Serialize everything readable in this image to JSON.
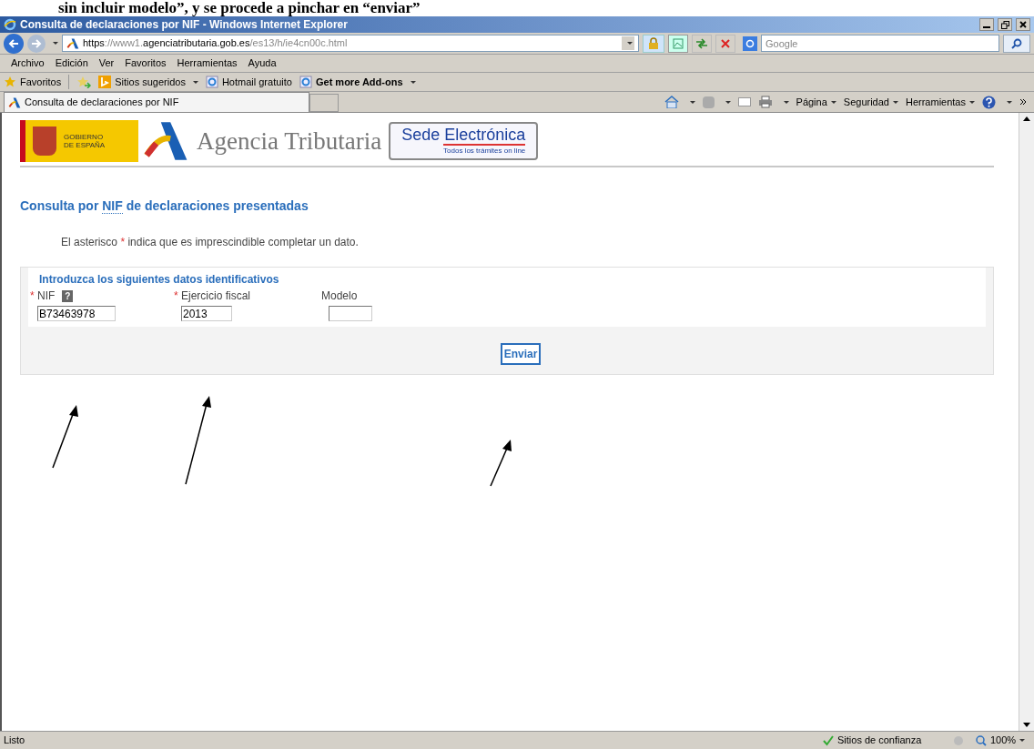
{
  "caption": "sin incluir modelo”, y se procede a pinchar en “enviar”",
  "window": {
    "title": "Consulta de declaraciones por NIF - Windows Internet Explorer"
  },
  "address": {
    "scheme": "https",
    "sep": "://",
    "host_pre": "www1.",
    "host": "agenciatributaria.gob.es",
    "path": "/es13/h/ie4cn00c.html"
  },
  "search": {
    "placeholder": "Google"
  },
  "menu": [
    "Archivo",
    "Edición",
    "Ver",
    "Favoritos",
    "Herramientas",
    "Ayuda"
  ],
  "favorites": {
    "label": "Favoritos",
    "links": [
      {
        "label": "Sitios sugeridos",
        "dropdown": true,
        "bold": false
      },
      {
        "label": "Hotmail gratuito",
        "dropdown": false,
        "bold": false
      },
      {
        "label": "Get more Add-ons",
        "dropdown": true,
        "bold": true
      }
    ]
  },
  "tab": {
    "title": "Consulta de declaraciones por NIF"
  },
  "commands": [
    "Página",
    "Seguridad",
    "Herramientas"
  ],
  "page": {
    "logo": {
      "gov": "GOBIERNO DE ESPAÑA",
      "agency": "Agencia Tributaria",
      "sede": "Sede Electrónica",
      "sede_tagline": "Todos los trámites on line"
    },
    "heading_pre": "Consulta por",
    "heading_abbr": "NIF",
    "heading_post": "de declaraciones presentadas",
    "note_pre": "El asterisco",
    "note_mark": "*",
    "note_post": "indica que es imprescindible completar un dato.",
    "form_title": "Introduzca los siguientes datos identificativos",
    "fields": [
      {
        "label": "NIF",
        "required": true,
        "help": "?",
        "value": "B73463978"
      },
      {
        "label": "Ejercicio fiscal",
        "required": true,
        "value": "2013"
      },
      {
        "label": "Modelo",
        "required": false
      }
    ],
    "submit": "Enviar"
  },
  "status": {
    "text": "Listo",
    "zone": "Sitios de confianza",
    "zoom": "100%"
  }
}
